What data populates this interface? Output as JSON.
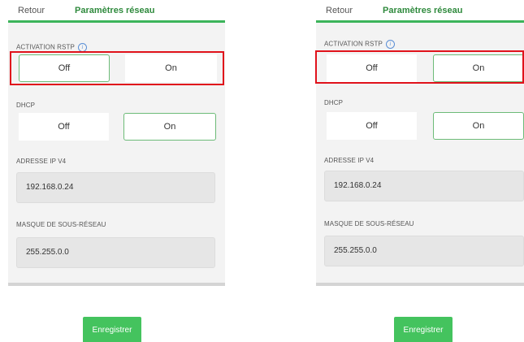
{
  "screens": [
    {
      "header": {
        "back_label": "Retour",
        "title": "Paramètres réseau"
      },
      "rstp": {
        "label": "ACTIVATION RSTP",
        "info_icon": "info-icon",
        "off_label": "Off",
        "on_label": "On",
        "selected": "Off"
      },
      "dhcp": {
        "label": "DHCP",
        "off_label": "Off",
        "on_label": "On",
        "selected": "On"
      },
      "ipv4": {
        "label": "ADRESSE IP V4",
        "value": "192.168.0.24"
      },
      "subnet": {
        "label": "MASQUE DE SOUS-RÉSEAU",
        "value": "255.255.0.0"
      },
      "save_label": "Enregistrer"
    },
    {
      "header": {
        "back_label": "Retour",
        "title": "Paramètres réseau"
      },
      "rstp": {
        "label": "ACTIVATION RSTP",
        "info_icon": "info-icon",
        "off_label": "Off",
        "on_label": "On",
        "selected": "On"
      },
      "dhcp": {
        "label": "DHCP",
        "off_label": "Off",
        "on_label": "On",
        "selected": "On"
      },
      "ipv4": {
        "label": "ADRESSE IP V4",
        "value": "192.168.0.24"
      },
      "subnet": {
        "label": "MASQUE DE SOUS-RÉSEAU",
        "value": "255.255.0.0"
      },
      "save_label": "Enregistrer"
    }
  ],
  "colors": {
    "accent": "#3cb45a",
    "title_green": "#2f8a3d",
    "highlight_red": "#e0121b",
    "save_button": "#44c35e"
  }
}
